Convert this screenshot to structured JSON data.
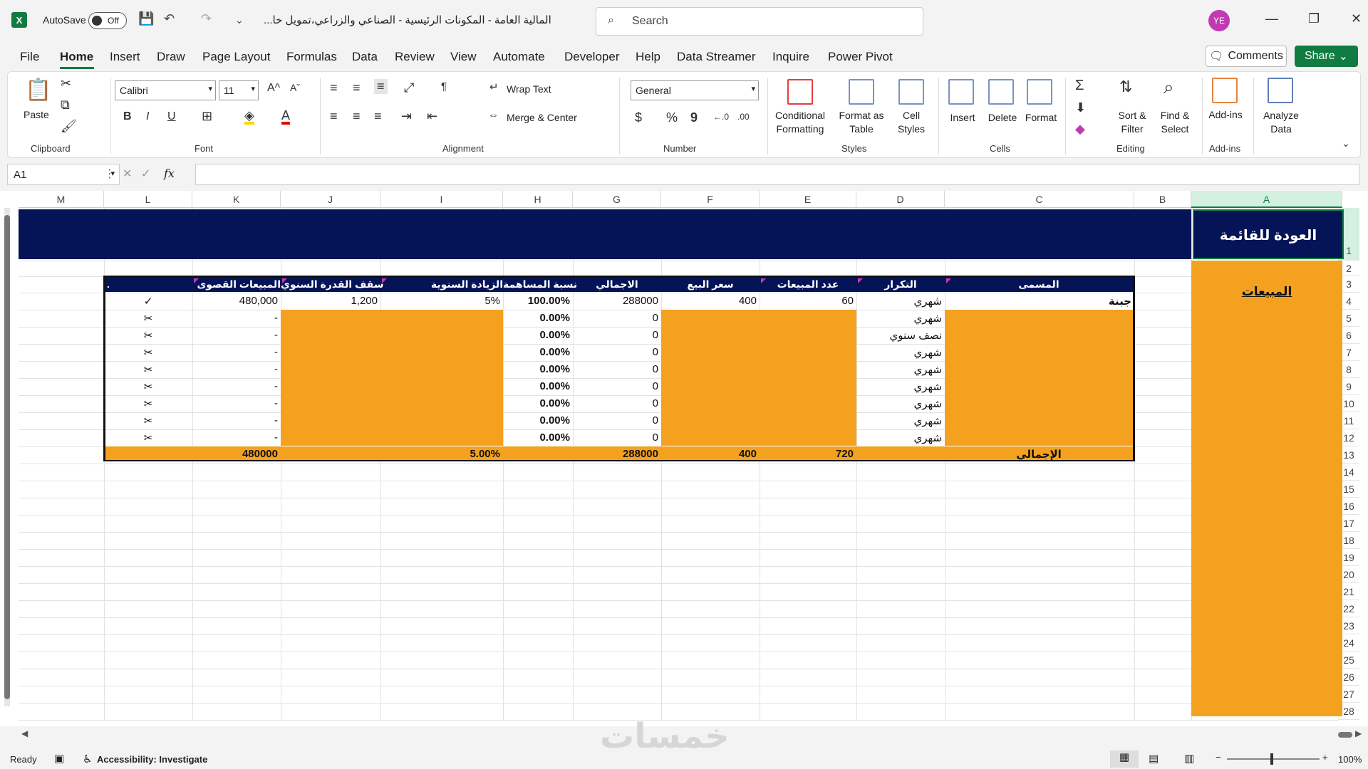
{
  "titlebar": {
    "app_icon": "X",
    "autosave_label": "AutoSave",
    "autosave_state": "Off",
    "doc_title": "المالية العامة - المكونات الرئيسية - الصناعي والزراعي،تمويل خا...",
    "search_placeholder": "Search",
    "user_initials": "YE"
  },
  "menu": {
    "tabs": [
      "File",
      "Home",
      "Insert",
      "Draw",
      "Page Layout",
      "Formulas",
      "Data",
      "Review",
      "View",
      "Automate",
      "Developer",
      "Help",
      "Data Streamer",
      "Inquire",
      "Power Pivot"
    ],
    "active": "Home",
    "comments_label": "Comments",
    "share_label": "Share"
  },
  "ribbon": {
    "clipboard": {
      "paste": "Paste",
      "label": "Clipboard"
    },
    "font": {
      "name": "Calibri",
      "size": "11",
      "label": "Font",
      "bold": "B",
      "italic": "I",
      "underline": "U"
    },
    "alignment": {
      "wrap_text": "Wrap Text",
      "merge_center": "Merge & Center",
      "label": "Alignment"
    },
    "number": {
      "format": "General",
      "label": "Number",
      "currency": "$",
      "percent": "%",
      "comma": "9"
    },
    "styles": {
      "conditional": "Conditional Formatting",
      "format_table": "Format as Table",
      "cell_styles": "Cell Styles",
      "label": "Styles"
    },
    "cells": {
      "insert": "Insert",
      "delete": "Delete",
      "format": "Format",
      "label": "Cells"
    },
    "editing": {
      "sort_filter": "Sort & Filter",
      "find_select": "Find & Select",
      "label": "Editing"
    },
    "addins": {
      "addins": "Add-ins",
      "label": "Add-ins"
    },
    "analyze": {
      "label": "Analyze Data"
    }
  },
  "formula_bar": {
    "name_box": "A1",
    "fx": "fx",
    "content": ""
  },
  "columns": [
    "M",
    "L",
    "K",
    "J",
    "I",
    "H",
    "G",
    "F",
    "E",
    "D",
    "C",
    "B",
    "A"
  ],
  "rows": [
    "1",
    "2",
    "3",
    "4",
    "5",
    "6",
    "7",
    "8",
    "9",
    "10",
    "11",
    "12",
    "13",
    "14",
    "15",
    "16",
    "17",
    "18",
    "19",
    "20",
    "21",
    "22",
    "23",
    "24",
    "25",
    "26",
    "27",
    "28"
  ],
  "sheet": {
    "back_link": "العودة للقائمة",
    "nav_item": "المبيعات",
    "headers": {
      "name": "المسمى",
      "repeat": "التكرار",
      "qty": "عدد المبيعات",
      "price": "سعر البيع",
      "total": "الاجمالي",
      "share": "نسبة المساهمة",
      "growth": "الزيادة السنوية",
      "cap": "سقف القدرة السنوي",
      "max_sales": "المبيعات القصوى",
      "check": "."
    },
    "rows": [
      {
        "name": "جبنة",
        "repeat": "شهري",
        "qty": "60",
        "price": "400",
        "total": "288000",
        "share": "100.00%",
        "growth": "5%",
        "cap": "1,200",
        "max_sales": "480,000",
        "check": "✓"
      },
      {
        "name": "",
        "repeat": "شهري",
        "qty": "",
        "price": "",
        "total": "0",
        "share": "0.00%",
        "growth": "",
        "cap": "",
        "max_sales": "-",
        "check": "✂"
      },
      {
        "name": "",
        "repeat": "نصف سنوي",
        "qty": "",
        "price": "",
        "total": "0",
        "share": "0.00%",
        "growth": "",
        "cap": "",
        "max_sales": "-",
        "check": "✂"
      },
      {
        "name": "",
        "repeat": "شهري",
        "qty": "",
        "price": "",
        "total": "0",
        "share": "0.00%",
        "growth": "",
        "cap": "",
        "max_sales": "-",
        "check": "✂"
      },
      {
        "name": "",
        "repeat": "شهري",
        "qty": "",
        "price": "",
        "total": "0",
        "share": "0.00%",
        "growth": "",
        "cap": "",
        "max_sales": "-",
        "check": "✂"
      },
      {
        "name": "",
        "repeat": "شهري",
        "qty": "",
        "price": "",
        "total": "0",
        "share": "0.00%",
        "growth": "",
        "cap": "",
        "max_sales": "-",
        "check": "✂"
      },
      {
        "name": "",
        "repeat": "شهري",
        "qty": "",
        "price": "",
        "total": "0",
        "share": "0.00%",
        "growth": "",
        "cap": "",
        "max_sales": "-",
        "check": "✂"
      },
      {
        "name": "",
        "repeat": "شهري",
        "qty": "",
        "price": "",
        "total": "0",
        "share": "0.00%",
        "growth": "",
        "cap": "",
        "max_sales": "-",
        "check": "✂"
      },
      {
        "name": "",
        "repeat": "شهري",
        "qty": "",
        "price": "",
        "total": "0",
        "share": "0.00%",
        "growth": "",
        "cap": "",
        "max_sales": "-",
        "check": "✂"
      }
    ],
    "totals": {
      "label": "الإجمالي",
      "qty": "720",
      "price": "400",
      "total": "288000",
      "growth": "5.00%",
      "max_sales": "480000"
    }
  },
  "status": {
    "ready": "Ready",
    "accessibility": "Accessibility: Investigate",
    "zoom": "100%",
    "watermark": "خمسات"
  },
  "colors": {
    "banner": "#041456",
    "orange": "#f4a11f",
    "excel_green": "#107c41"
  }
}
